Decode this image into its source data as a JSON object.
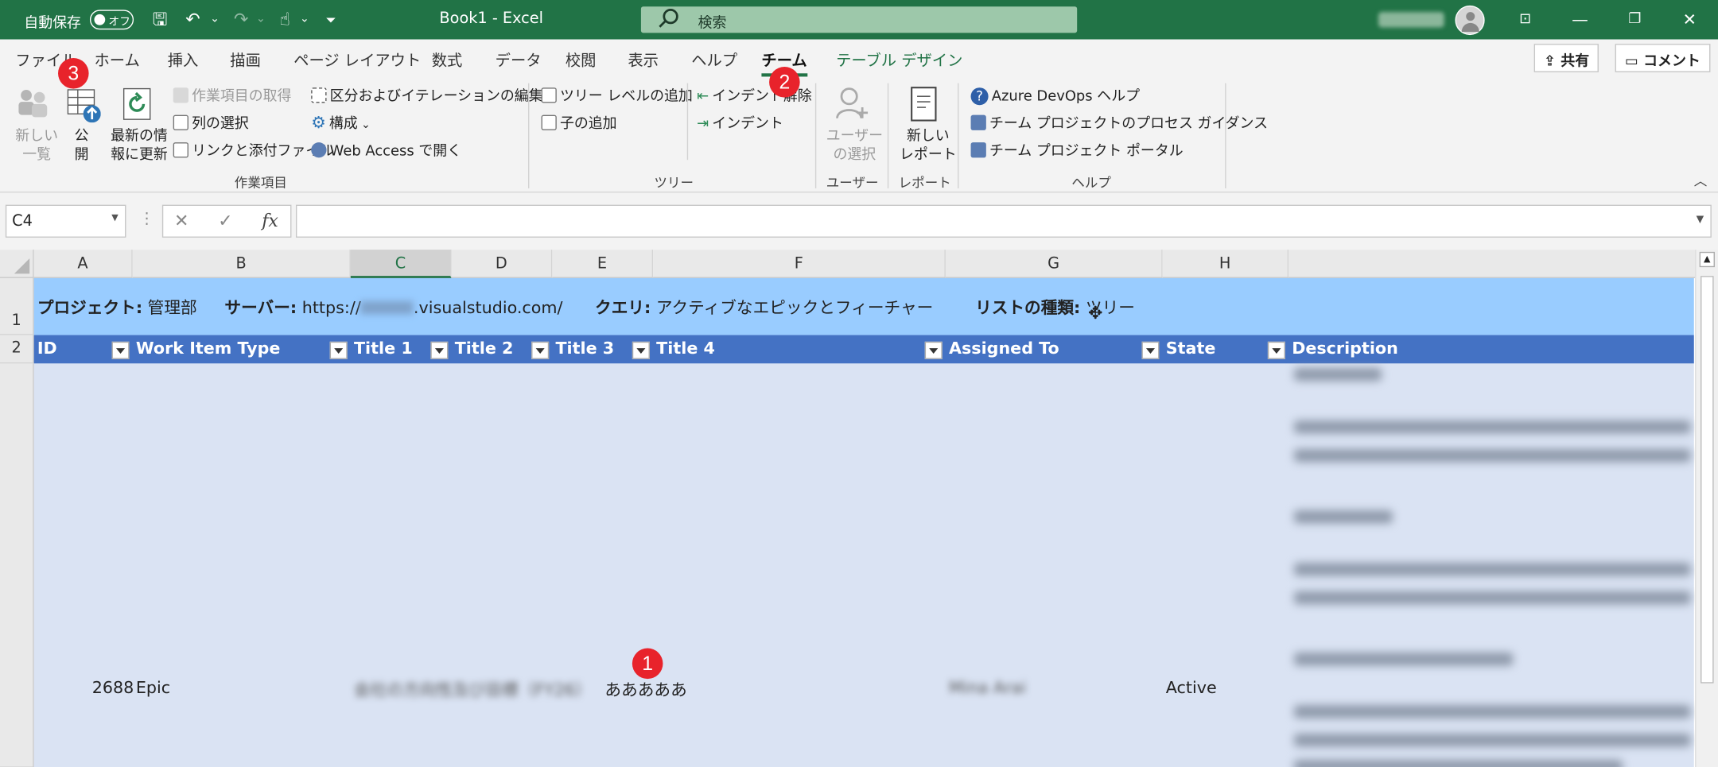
{
  "titlebar": {
    "autosave_label": "自動保存",
    "autosave_state": "オフ",
    "title": "Book1  -  Excel",
    "search_placeholder": "検索"
  },
  "tabs": [
    {
      "label": "ファイル"
    },
    {
      "label": "ホーム"
    },
    {
      "label": "挿入"
    },
    {
      "label": "描画"
    },
    {
      "label": "ページ レイアウト"
    },
    {
      "label": "数式"
    },
    {
      "label": "データ"
    },
    {
      "label": "校閲"
    },
    {
      "label": "表示"
    },
    {
      "label": "ヘルプ"
    },
    {
      "label": "チーム"
    },
    {
      "label": "テーブル デザイン"
    }
  ],
  "share_label": "共有",
  "comment_label": "コメント",
  "ribbon": {
    "work_items": {
      "new_list": "新しい\n一覧",
      "publish": "公\n開",
      "refresh": "最新の情\n報に更新",
      "get_work_items": "作業項目の取得",
      "choose_columns": "列の選択",
      "links_attachments": "リンクと添付ファイル",
      "edit_areas": "区分およびイテレーションの編集",
      "configure": "構成",
      "open_web_access": "Web Access で開く",
      "group_label": "作業項目"
    },
    "tree": {
      "add_tree_level": "ツリー レベルの追加",
      "add_child": "子の追加",
      "outdent": "インデント解除",
      "indent": "インデント",
      "group_label": "ツリー"
    },
    "users": {
      "select_user": "ユーザー\nの選択",
      "group_label": "ユーザー"
    },
    "reports": {
      "new_report": "新しい\nレポート",
      "group_label": "レポート"
    },
    "help": {
      "devops_help": "Azure DevOps ヘルプ",
      "process_guidance": "チーム プロジェクトのプロセス ガイダンス",
      "project_portal": "チーム プロジェクト ポータル",
      "group_label": "ヘルプ"
    }
  },
  "badges": [
    "1",
    "2",
    "3"
  ],
  "namebox": "C4",
  "formula_value": "",
  "columns": [
    "A",
    "B",
    "C",
    "D",
    "E",
    "F",
    "G",
    "H"
  ],
  "rows": [
    "1",
    "2"
  ],
  "row1": {
    "project_label": "プロジェクト:",
    "project_value": "管理部",
    "server_label": "サーバー:",
    "server_value_prefix": "https://",
    "server_value_suffix": ".visualstudio.com/",
    "query_label": "クエリ:",
    "query_value": "アクティブなエピックとフィーチャー",
    "list_type_label": "リストの種類:",
    "list_type_value": "ツリー"
  },
  "headers": [
    "ID",
    "Work Item Type",
    "Title 1",
    "Title 2",
    "Title 3",
    "Title 4",
    "Assigned To",
    "State",
    "Description"
  ],
  "data_row": {
    "id": "2688",
    "type": "Epic",
    "title1": "会社の方向性及び目標（FY26）",
    "title3": "あああああ",
    "assigned": "Mina Arai",
    "state": "Active"
  },
  "colors": {
    "title_green": "#217346",
    "header_blue": "#4472c4",
    "info_blue": "#99ccff",
    "row_band": "#dae3f3",
    "badge_red": "#e8232b"
  }
}
